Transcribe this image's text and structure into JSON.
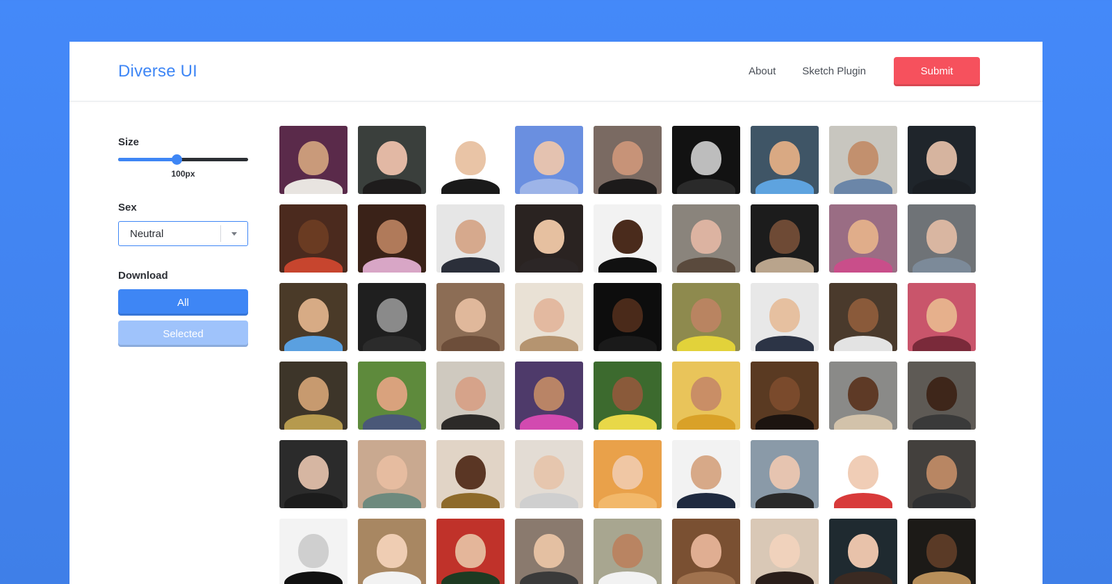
{
  "header": {
    "brand": "Diverse UI",
    "nav": [
      "About",
      "Sketch Plugin"
    ],
    "submit_label": "Submit"
  },
  "sidebar": {
    "size_label": "Size",
    "size_value": "100px",
    "size_fraction": 0.45,
    "sex_label": "Sex",
    "sex_value": "Neutral",
    "download_label": "Download",
    "all_label": "All",
    "selected_label": "Selected"
  },
  "colors": {
    "accent": "#3e86f5",
    "submit": "#f6515d",
    "background": "#4489f9"
  },
  "avatars": [
    {
      "bg": "#5a2a4a",
      "skin": "#c99a7a",
      "cloth": "#e8e4e0"
    },
    {
      "bg": "#3a3f3c",
      "skin": "#e2b8a4",
      "cloth": "#1e1c1c"
    },
    {
      "bg": "#ffffff",
      "skin": "#e9c4a6",
      "cloth": "#1a1a1a"
    },
    {
      "bg": "#6a8fe0",
      "skin": "#e4c2b0",
      "cloth": "#9db4e8"
    },
    {
      "bg": "#7a6a62",
      "skin": "#c79378",
      "cloth": "#1c1a1a"
    },
    {
      "bg": "#121212",
      "skin": "#bdbdbd",
      "cloth": "#2a2a2a"
    },
    {
      "bg": "#3f5566",
      "skin": "#d9a983",
      "cloth": "#5ea3df"
    },
    {
      "bg": "#c8c6bf",
      "skin": "#c2906e",
      "cloth": "#6b86a8"
    },
    {
      "bg": "#1f252b",
      "skin": "#d6b49f",
      "cloth": "#1b1f24"
    },
    {
      "bg": "#4b2a1e",
      "skin": "#6a3b22",
      "cloth": "#c7452e"
    },
    {
      "bg": "#3a2218",
      "skin": "#b07a5a",
      "cloth": "#d8a6c6"
    },
    {
      "bg": "#e6e6e6",
      "skin": "#d6a98d",
      "cloth": "#2b2f3a"
    },
    {
      "bg": "#2a2321",
      "skin": "#e6c0a0",
      "cloth": "#2c2626"
    },
    {
      "bg": "#f2f2f2",
      "skin": "#4a2b1c",
      "cloth": "#111111"
    },
    {
      "bg": "#8a847c",
      "skin": "#dcb3a1",
      "cloth": "#5a4a3d"
    },
    {
      "bg": "#1c1c1c",
      "skin": "#6e4a35",
      "cloth": "#b9a48c"
    },
    {
      "bg": "#9a6d84",
      "skin": "#e0ad8a",
      "cloth": "#c94e8a"
    },
    {
      "bg": "#6f7377",
      "skin": "#d9b6a1",
      "cloth": "#7c8a99"
    },
    {
      "bg": "#4a3a28",
      "skin": "#d7ab85",
      "cloth": "#5aa0e0"
    },
    {
      "bg": "#1f1f1f",
      "skin": "#8a8a8a",
      "cloth": "#2b2b2b"
    },
    {
      "bg": "#8c6d55",
      "skin": "#e0b89b",
      "cloth": "#6d4e3a"
    },
    {
      "bg": "#e9e1d5",
      "skin": "#e3b9a0",
      "cloth": "#b59470"
    },
    {
      "bg": "#0d0d0d",
      "skin": "#4a2a1a",
      "cloth": "#1a1a1a"
    },
    {
      "bg": "#8e8a4e",
      "skin": "#b98461",
      "cloth": "#e2d23a"
    },
    {
      "bg": "#e8e8e8",
      "skin": "#e6c0a0",
      "cloth": "#2c3446"
    },
    {
      "bg": "#4a3a2c",
      "skin": "#8a5a3a",
      "cloth": "#e3e3e3"
    },
    {
      "bg": "#c9556b",
      "skin": "#e6b08c",
      "cloth": "#7a2a3a"
    },
    {
      "bg": "#3d3529",
      "skin": "#c79a6f",
      "cloth": "#b69a4e"
    },
    {
      "bg": "#5e8a3c",
      "skin": "#d9a27d",
      "cloth": "#4a5878"
    },
    {
      "bg": "#cfc9bf",
      "skin": "#d6a38a",
      "cloth": "#2c2a28"
    },
    {
      "bg": "#4e3a6a",
      "skin": "#b98466",
      "cloth": "#d24ab0"
    },
    {
      "bg": "#3c6a2e",
      "skin": "#8a5a3a",
      "cloth": "#e8d848"
    },
    {
      "bg": "#e9c45a",
      "skin": "#c98e66",
      "cloth": "#d9a128"
    },
    {
      "bg": "#5a3a22",
      "skin": "#7a4a2c",
      "cloth": "#1c1410"
    },
    {
      "bg": "#8a8a88",
      "skin": "#5e3a26",
      "cloth": "#d2c2aa"
    },
    {
      "bg": "#5e5a55",
      "skin": "#3e261a",
      "cloth": "#3a3a3a"
    },
    {
      "bg": "#2b2b2b",
      "skin": "#d6b6a2",
      "cloth": "#1c1c1c"
    },
    {
      "bg": "#c9a990",
      "skin": "#e6bca0",
      "cloth": "#6e8a7e"
    },
    {
      "bg": "#e1d4c6",
      "skin": "#5a3624",
      "cloth": "#8e6a2a"
    },
    {
      "bg": "#e3dcd4",
      "skin": "#e6c6ae",
      "cloth": "#cfcfcf"
    },
    {
      "bg": "#e9a14a",
      "skin": "#f0c7a4",
      "cloth": "#f2b86a"
    },
    {
      "bg": "#f2f2f2",
      "skin": "#d7a988",
      "cloth": "#1f2a3f"
    },
    {
      "bg": "#8a9aa8",
      "skin": "#e6c4b0",
      "cloth": "#2a2a2a"
    },
    {
      "bg": "#ffffff",
      "skin": "#f0cdb6",
      "cloth": "#d83a3a"
    },
    {
      "bg": "#43403d",
      "skin": "#b88663",
      "cloth": "#2f3032"
    },
    {
      "bg": "#f3f3f3",
      "skin": "#cfcfcf",
      "cloth": "#111111"
    },
    {
      "bg": "#a88762",
      "skin": "#efcdb3",
      "cloth": "#f2f2f2"
    },
    {
      "bg": "#c0322a",
      "skin": "#e4b69a",
      "cloth": "#1e3a22"
    },
    {
      "bg": "#8a7a6e",
      "skin": "#e4c0a2",
      "cloth": "#3a3a3a"
    },
    {
      "bg": "#a8a690",
      "skin": "#b98462",
      "cloth": "#f2f2f2"
    },
    {
      "bg": "#7a5032",
      "skin": "#e0ae92",
      "cloth": "#a0724e"
    },
    {
      "bg": "#d9c8b6",
      "skin": "#f0d2bc",
      "cloth": "#2a1e1a"
    },
    {
      "bg": "#1f2a30",
      "skin": "#e8c2aa",
      "cloth": "#3a2a22"
    },
    {
      "bg": "#1c1a17",
      "skin": "#5a3a26",
      "cloth": "#b88f5a"
    }
  ]
}
